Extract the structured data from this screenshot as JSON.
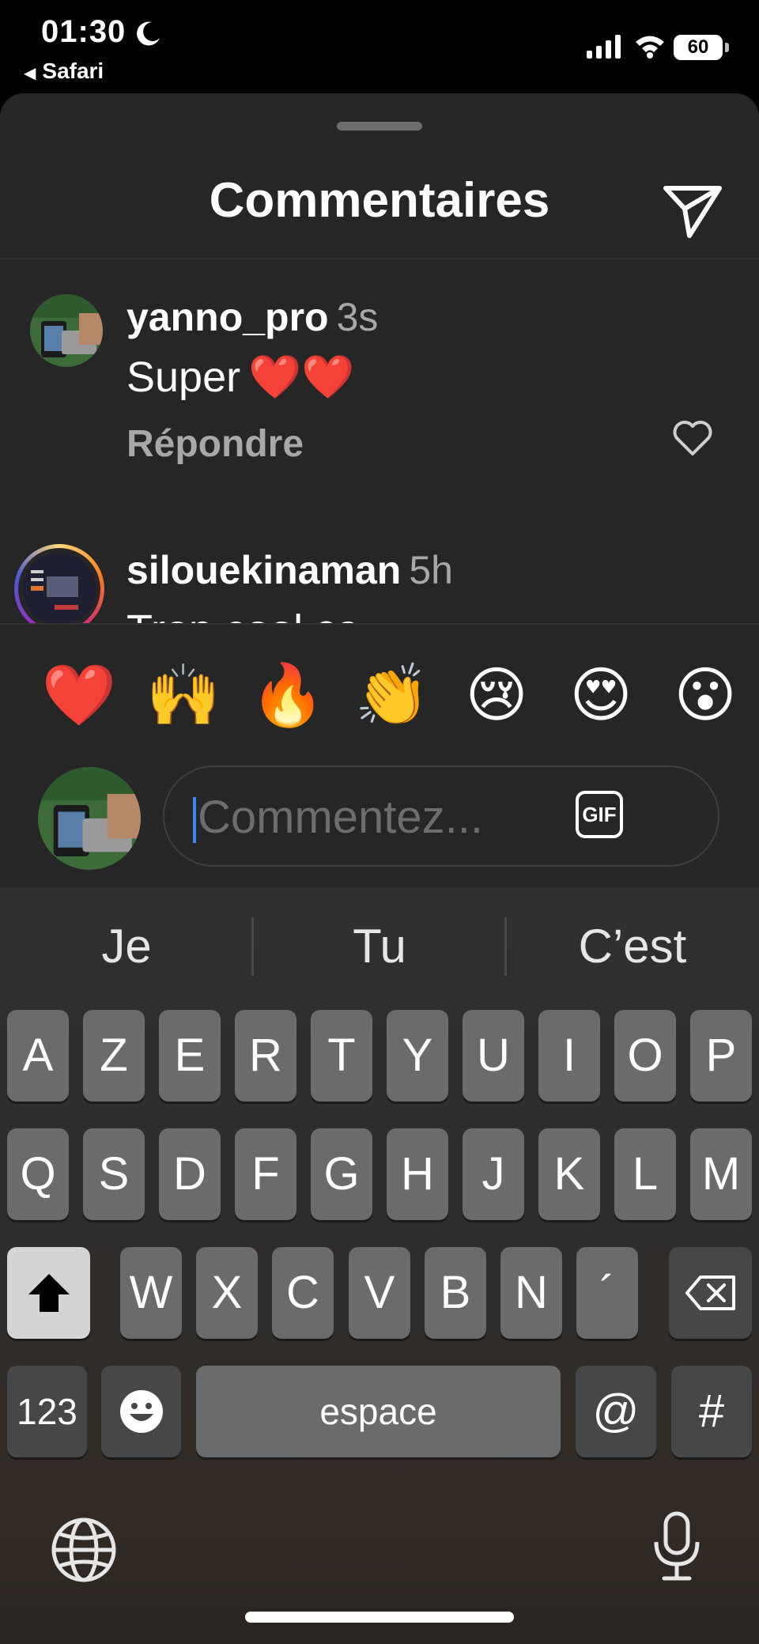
{
  "status_bar": {
    "time": "01:30",
    "back_app": "Safari",
    "battery": "60",
    "icons": [
      "moon-icon",
      "signal-icon",
      "wifi-icon",
      "battery-icon"
    ]
  },
  "sheet": {
    "title": "Commentaires",
    "share_icon": "paper-plane-icon"
  },
  "comments": [
    {
      "username": "yanno_pro",
      "time": "3s",
      "text": "Super",
      "hearts": "❤️❤️",
      "reply": "Répondre"
    },
    {
      "username": "silouekinaman",
      "time": "5h",
      "text": "Trop cool ça"
    }
  ],
  "emoji_reactions": [
    "❤️",
    "🙌",
    "🔥",
    "👏",
    "😢",
    "😍",
    "😮"
  ],
  "composer": {
    "placeholder": "Commentez...",
    "gif_label": "GIF"
  },
  "keyboard": {
    "suggestions": [
      "Je",
      "Tu",
      "C’est"
    ],
    "row1": [
      "A",
      "Z",
      "E",
      "R",
      "T",
      "Y",
      "U",
      "I",
      "O",
      "P"
    ],
    "row2": [
      "Q",
      "S",
      "D",
      "F",
      "G",
      "H",
      "J",
      "K",
      "L",
      "M"
    ],
    "row3": [
      "W",
      "X",
      "C",
      "V",
      "B",
      "N",
      "´"
    ],
    "numbers_label": "123",
    "space_label": "espace",
    "at_label": "@",
    "hash_label": "#"
  },
  "colors": {
    "sheet_bg": "#262626",
    "heart_red": "#e0201e",
    "caret_blue": "#3e82f7"
  }
}
